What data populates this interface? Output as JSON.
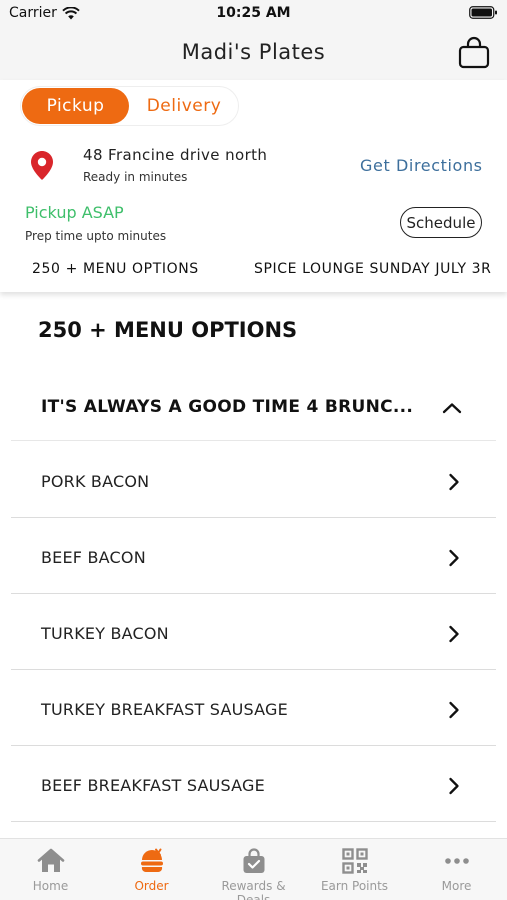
{
  "status_bar": {
    "carrier": "Carrier",
    "time": "10:25 AM"
  },
  "nav": {
    "title": "Madi's Plates"
  },
  "order_mode": {
    "pickup_label": "Pickup",
    "delivery_label": "Delivery",
    "selected": "Pickup"
  },
  "location": {
    "address": "48 Francine drive north",
    "ready_text": "Ready in minutes",
    "directions_label": "Get Directions"
  },
  "timing": {
    "pickup_asap": "Pickup ASAP",
    "prep_time": "Prep time upto minutes",
    "schedule_label": "Schedule"
  },
  "category_tabs": [
    "250 + MENU OPTIONS",
    "SPICE LOUNGE SUNDAY JULY 3R"
  ],
  "section": {
    "title": "250 + MENU OPTIONS"
  },
  "group": {
    "title": "IT'S ALWAYS A GOOD TIME 4 BRUNC..."
  },
  "menu_items": [
    "PORK BACON",
    "BEEF BACON",
    "TURKEY BACON",
    "TURKEY BREAKFAST SAUSAGE",
    "BEEF BREAKFAST SAUSAGE"
  ],
  "tab_bar": {
    "items": [
      {
        "label": "Home",
        "icon": "home-icon"
      },
      {
        "label": "Order",
        "icon": "order-icon"
      },
      {
        "label": "Rewards & Deals",
        "icon": "rewards-bag-icon"
      },
      {
        "label": "Earn Points",
        "icon": "qr-code-icon"
      },
      {
        "label": "More",
        "icon": "more-dots-icon"
      }
    ],
    "active": "Order"
  },
  "colors": {
    "accent": "#ee6a12",
    "link": "#3d6f9c",
    "success": "#3fbf6b",
    "pin": "#d9262b"
  }
}
